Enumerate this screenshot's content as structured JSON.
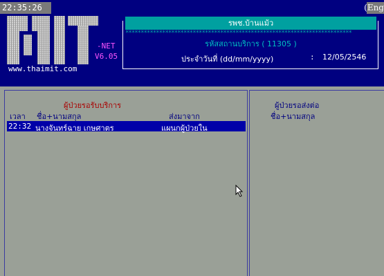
{
  "header": {
    "clock": "22:35:26",
    "language_indicator": "(Eng",
    "net_label": "-NET",
    "version": "V6.05",
    "website": "www.thaimit.com"
  },
  "hospital": {
    "name": "รพช.บ้านแม้ว",
    "separator": "**************************************************************************",
    "service_code_line": "รหัสสถานบริการ ( 11305 )",
    "date_label": "ประจำวันที่ (dd/mm/yyyy)",
    "date_colon": ":",
    "date_value": "12/05/2546"
  },
  "left_panel": {
    "title": "ผู้ป่วยรอรับบริการ",
    "columns": [
      "เวลา",
      "ชื่อ+นามสกุล",
      "ส่งมาจาก"
    ],
    "rows": [
      {
        "time": "22:32",
        "name": "นางจันทร์ฉาย เกษศาตร",
        "from": "แผนกผู้ป่วยใน",
        "selected": true
      }
    ]
  },
  "right_panel": {
    "title": "ผู้ป่วยรอส่งต่อ",
    "columns": [
      "ชื่อ+นามสกุล"
    ]
  },
  "colors": {
    "header_bg": "#000080",
    "body_bg": "#9aa097",
    "accent_cyan": "#00a0a0",
    "selected_row": "#0000a8",
    "title_red": "#aa0000",
    "magenta": "#ff55ff"
  },
  "icons": {
    "cursor": "mouse-pointer-icon",
    "logo": "mit-logo-icon"
  }
}
